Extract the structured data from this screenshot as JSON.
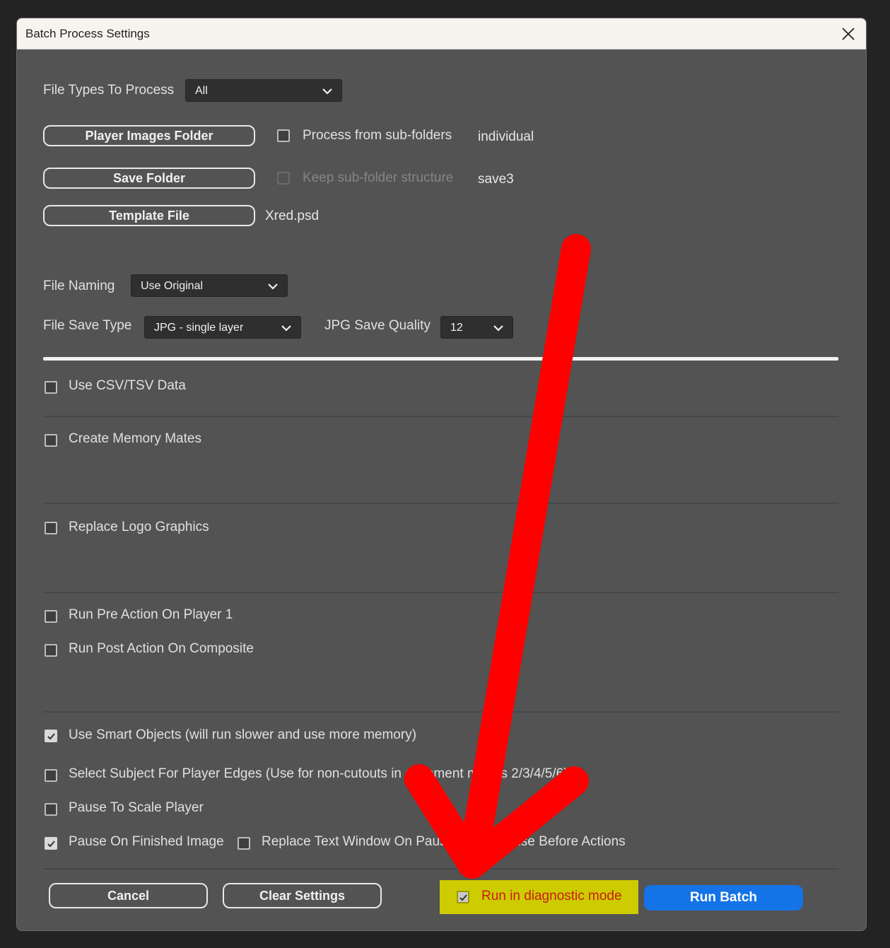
{
  "window": {
    "title": "Batch Process Settings"
  },
  "file_types": {
    "label": "File Types To Process",
    "value": "All"
  },
  "folders": {
    "player_images_button": "Player Images Folder",
    "process_subfolders_label": "Process from sub-folders",
    "player_images_value": "individual",
    "save_folder_button": "Save Folder",
    "keep_structure_label": "Keep sub-folder structure",
    "save_folder_value": "save3",
    "template_button": "Template File",
    "template_value": "Xred.psd"
  },
  "naming": {
    "label": "File Naming",
    "value": "Use Original"
  },
  "save_type": {
    "label": "File Save Type",
    "value": "JPG - single layer",
    "quality_label": "JPG Save Quality",
    "quality_value": "12"
  },
  "options": {
    "use_csv": "Use CSV/TSV Data",
    "memory_mates": "Create Memory Mates",
    "replace_logo": "Replace Logo Graphics",
    "pre_action": "Run Pre Action On Player 1",
    "post_action": "Run Post Action On Composite",
    "smart_objects": "Use Smart Objects (will run slower and use more memory)",
    "select_subject": "Select Subject For Player Edges (Use for non-cutouts in alignment modes 2/3/4/5/6)",
    "pause_scale": "Pause To Scale Player",
    "pause_finished": "Pause On Finished Image",
    "replace_text_window": "Replace Text Window On Pause",
    "pause_before_actions": "Pause Before Actions"
  },
  "checked": {
    "smart_objects": true,
    "pause_finished": true,
    "diagnostic": true
  },
  "footer": {
    "cancel": "Cancel",
    "clear_settings": "Clear Settings",
    "diagnostic_label": "Run in diagnostic mode",
    "run_batch": "Run Batch"
  },
  "colors": {
    "dialog_bg": "#535353",
    "accent_blue": "#1473e6",
    "highlight_yellow": "#cccc00",
    "diagnostic_text": "#cc1a1a",
    "annotation_red": "#ff0000"
  },
  "icons": [
    "close-icon",
    "chevron-down-icon",
    "checkmark-icon",
    "red-arrow-annotation"
  ]
}
